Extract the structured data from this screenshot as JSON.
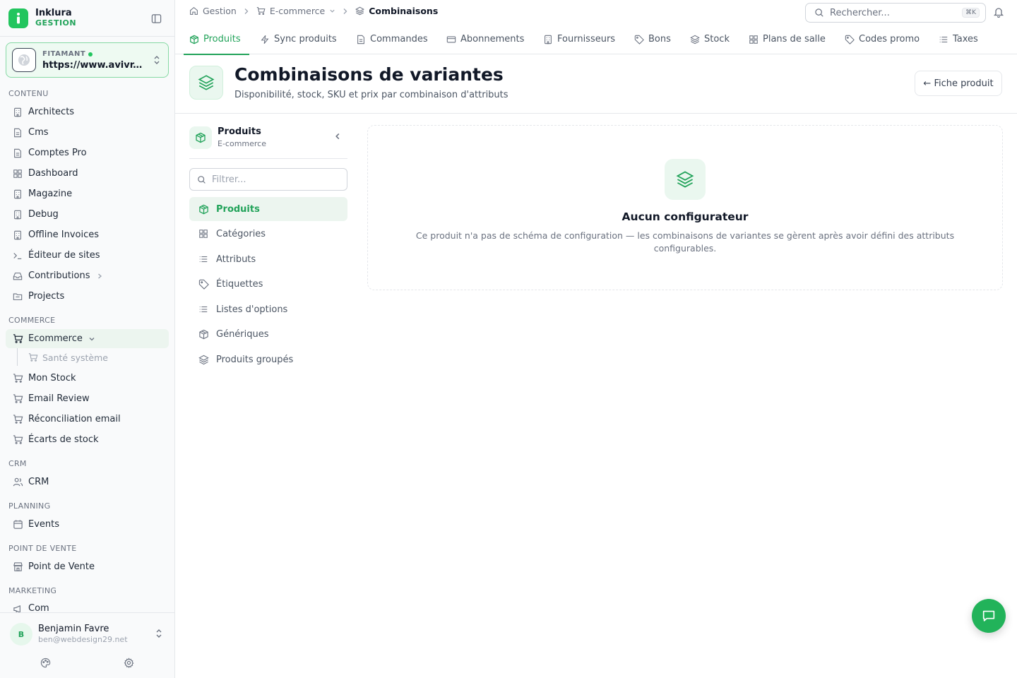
{
  "brand": {
    "name": "Inklura",
    "subtitle": "GESTION"
  },
  "site": {
    "label": "FITAMANT",
    "url": "https://www.avivr..."
  },
  "sidebar": {
    "sections": {
      "contenu": "CONTENU",
      "commerce": "COMMERCE",
      "crm": "CRM",
      "planning": "PLANNING",
      "pos": "POINT DE VENTE",
      "marketing": "MARKETING"
    },
    "contenu_items": [
      {
        "label": "Architects",
        "icon": "building-icon"
      },
      {
        "label": "Cms",
        "icon": "file-icon"
      },
      {
        "label": "Comptes Pro",
        "icon": "file-icon"
      },
      {
        "label": "Dashboard",
        "icon": "grid-icon"
      },
      {
        "label": "Magazine",
        "icon": "building-icon"
      },
      {
        "label": "Debug",
        "icon": "building-icon"
      },
      {
        "label": "Offline Invoices",
        "icon": "building-icon"
      },
      {
        "label": "Éditeur de sites",
        "icon": "terminal-icon"
      },
      {
        "label": "Contributions",
        "icon": "inbox-icon"
      },
      {
        "label": "Projects",
        "icon": "folder-icon"
      }
    ],
    "commerce_items": [
      {
        "label": "Ecommerce",
        "icon": "cart-icon"
      },
      {
        "label": "Mon Stock",
        "icon": "cart-icon"
      },
      {
        "label": "Email Review",
        "icon": "cart-icon"
      },
      {
        "label": "Réconciliation email",
        "icon": "cart-icon"
      },
      {
        "label": "Écarts de stock",
        "icon": "cart-icon"
      }
    ],
    "ecommerce_sub": "Santé système",
    "crm_item": "CRM",
    "planning_item": "Events",
    "pos_item": "Point de Vente",
    "marketing_item": "Com"
  },
  "user": {
    "initial": "B",
    "name": "Benjamin Favre",
    "email": "ben@webdesign29.net"
  },
  "breadcrumb": {
    "home": "Gestion",
    "section": "E-commerce",
    "current": "Combinaisons"
  },
  "search": {
    "placeholder": "Rechercher...",
    "shortcut": "⌘K"
  },
  "tabs": [
    {
      "label": "Produits",
      "icon": "box-icon",
      "active": true
    },
    {
      "label": "Sync produits",
      "icon": "zap-icon"
    },
    {
      "label": "Commandes",
      "icon": "file-icon"
    },
    {
      "label": "Abonnements",
      "icon": "card-icon"
    },
    {
      "label": "Fournisseurs",
      "icon": "building-icon"
    },
    {
      "label": "Bons",
      "icon": "tag-icon"
    },
    {
      "label": "Stock",
      "icon": "layers-icon"
    },
    {
      "label": "Plans de salle",
      "icon": "grid-icon"
    },
    {
      "label": "Codes promo",
      "icon": "tag-icon"
    },
    {
      "label": "Taxes",
      "icon": "list-icon"
    }
  ],
  "header": {
    "title": "Combinaisons de variantes",
    "subtitle": "Disponibilité, stock, SKU et prix par combinaison d'attributs",
    "back_button": "← Fiche produit"
  },
  "inner": {
    "title": "Produits",
    "subtitle": "E-commerce",
    "filter_placeholder": "Filtrer...",
    "items": [
      {
        "label": "Produits",
        "icon": "box-icon",
        "active": true
      },
      {
        "label": "Catégories",
        "icon": "grid-icon"
      },
      {
        "label": "Attributs",
        "icon": "list-icon"
      },
      {
        "label": "Étiquettes",
        "icon": "tag-icon"
      },
      {
        "label": "Listes d'options",
        "icon": "list-icon"
      },
      {
        "label": "Génériques",
        "icon": "box-icon"
      },
      {
        "label": "Produits groupés",
        "icon": "layers-icon"
      }
    ]
  },
  "empty_state": {
    "title": "Aucun configurateur",
    "text": "Ce produit n'a pas de schéma de configuration — les combinaisons de variantes se gèrent après avoir défini des attributs configurables."
  },
  "colors": {
    "accent": "#22a35a",
    "accent_bg": "#ecf5ef"
  }
}
